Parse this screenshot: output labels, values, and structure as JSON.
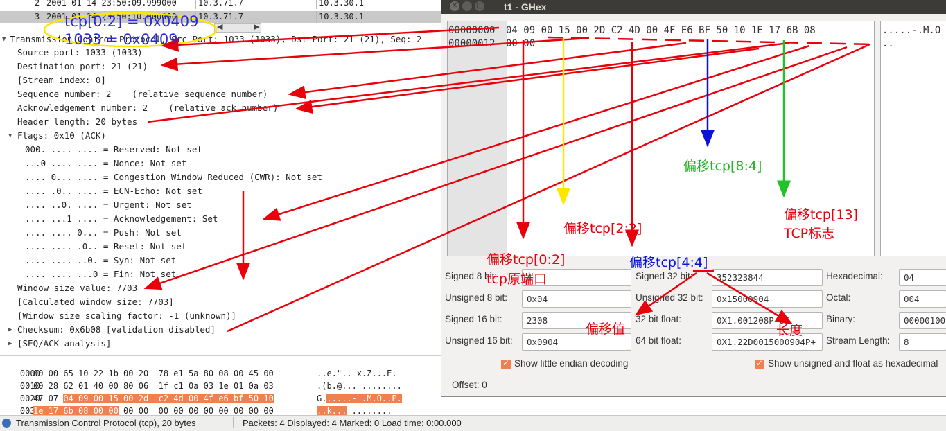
{
  "packet_list": {
    "rows": [
      {
        "no": "2",
        "time": "2001-01-14 23:50:09.999000",
        "src": "10.3.71.7",
        "dst": "10.3.30.1"
      },
      {
        "no": "3",
        "time": "2001-01-14 23:50:10.000000",
        "src": "10.3.71.7",
        "dst": "10.3.30.1"
      }
    ]
  },
  "tree": {
    "header": "Transmission Control Protocol, Src Port: 1033 (1033), Dst Port: 21 (21), Seq: 2",
    "lines": [
      "Source port: 1033 (1033)",
      "Destination port: 21 (21)",
      "[Stream index: 0]",
      "Sequence number: 2    (relative sequence number)",
      "Acknowledgement number: 2    (relative ack number)",
      "Header length: 20 bytes"
    ],
    "flags_header": "Flags: 0x10 (ACK)",
    "flags": [
      "000. .... .... = Reserved: Not set",
      "...0 .... .... = Nonce: Not set",
      ".... 0... .... = Congestion Window Reduced (CWR): Not set",
      ".... .0.. .... = ECN-Echo: Not set",
      ".... ..0. .... = Urgent: Not set",
      ".... ...1 .... = Acknowledgement: Set",
      ".... .... 0... = Push: Not set",
      ".... .... .0.. = Reset: Not set",
      ".... .... ..0. = Syn: Not set",
      ".... .... ...0 = Fin: Not set"
    ],
    "after_flags": [
      "Window size value: 7703",
      "[Calculated window size: 7703]",
      "[Window size scaling factor: -1 (unknown)]"
    ],
    "checksum": "Checksum: 0x6b08 [validation disabled]",
    "seqack": "[SEQ/ACK analysis]"
  },
  "bytes_pane": {
    "rows": [
      {
        "offset": "0000",
        "hex_plain": "00 00 65 10 22 1b 00 20  78 e1 5a 80 08 00 45 00",
        "hex_hl": "",
        "hex_tail": "",
        "ascii_plain": "..e.\".. x.Z...E.",
        "ascii_hl": "",
        "ascii_tail": ""
      },
      {
        "offset": "0010",
        "hex_plain": "00 28 62 01 40 00 80 06  1f c1 0a 03 1e 01 0a 03",
        "hex_hl": "",
        "hex_tail": "",
        "ascii_plain": ".(b.@... ........",
        "ascii_hl": "",
        "ascii_tail": ""
      },
      {
        "offset": "0020",
        "hex_plain": "47 07 ",
        "hex_hl": "04 09 00 15 00 2d  c2 4d 00 4f e6 bf 50 10",
        "hex_tail": "",
        "ascii_plain": "G.",
        "ascii_hl": ".....- .M.O..P.",
        "ascii_tail": ""
      },
      {
        "offset": "0030",
        "hex_plain": "",
        "hex_hl": "1e 17 6b 08 00 00",
        "hex_tail": " 00 00  00 00 00 00 00 00 00 00",
        "ascii_plain": "",
        "ascii_hl": "..k...",
        "ascii_tail": " ........"
      }
    ]
  },
  "status": {
    "field": "Transmission Control Protocol (tcp), 20 bytes",
    "packets": "Packets: 4 Displayed: 4 Marked: 0 Load time: 0:00.000"
  },
  "ghex": {
    "title": "t1 - GHex",
    "offsets": [
      "00000000",
      "00000012"
    ],
    "hex_rows": [
      "04 09 00 15 00 2D C2 4D 00 4F E6 BF 50 10 1E 17 6B 08",
      "00 00"
    ],
    "ascii_rows": [
      ".....-.M.O",
      ".."
    ],
    "fields": {
      "signed8_label": "Signed 8 bit:",
      "signed8": "4",
      "unsigned8_label": "Unsigned 8 bit:",
      "unsigned8": "0x04",
      "signed16_label": "Signed 16 bit:",
      "signed16": "2308",
      "unsigned16_label": "Unsigned 16 bit:",
      "unsigned16": "0x0904",
      "signed32_label": "Signed 32 bit:",
      "signed32": "352323844",
      "unsigned32_label": "Unsigned 32 bit:",
      "unsigned32": "0x15000904",
      "float32_label": "32 bit float:",
      "float32": "0X1.001208P-85",
      "float64_label": "64 bit float:",
      "float64": "0X1.22D0015000904P+",
      "hex_label": "Hexadecimal:",
      "hex": "04",
      "octal_label": "Octal:",
      "octal": "004",
      "binary_label": "Binary:",
      "binary": "00000100",
      "stream_label": "Stream Length:",
      "stream": "8"
    },
    "check_little_endian": "Show little endian decoding",
    "check_unsigned_hex": "Show unsigned and float as hexadecimal",
    "offset_status": "Offset: 0"
  },
  "annotations": {
    "tcp02_eq": "tcp[0:2] = 0x0409",
    "eq_1033": "1033 = 0x0409",
    "off_8_4": "偏移tcp[8:4]",
    "off_13": "偏移tcp[13]",
    "tcp_flags": "TCP标志",
    "off_2_2": "偏移tcp[2:2]",
    "off_0_2": "偏移tcp[0:2]",
    "src_port": "tcp原端口",
    "off_4_4": "偏移tcp[4:4]",
    "offset_val": "偏移值",
    "length": "长度"
  },
  "colors": {
    "highlight": "#f08050",
    "red": "#e8000b",
    "yellow": "#ffe600",
    "blue": "#0a14d8",
    "green": "#22c22a"
  }
}
